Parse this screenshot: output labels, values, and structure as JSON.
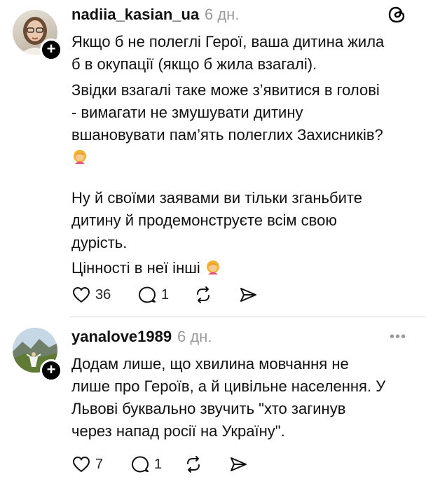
{
  "post1": {
    "username": "nadiia_kasian_ua",
    "time": "6 дн.",
    "lines_a": [
      "Якщо б не полеглі Герої, ваша дитина жила",
      "б в окупації (якщо б жила взагалі).",
      "Звідки взагалі таке може з’явитися в голові",
      "- вимагати не змушувати дитину",
      "вшановувати пам’ять полеглих Захисників?"
    ],
    "lines_b": [
      "Ну й своїми заявами ви тільки зганьбите",
      "дитину й продемонструєте всім свою",
      "дурість."
    ],
    "last_line": "Цінності в неї інші",
    "emoji_icon": "woman-facepalming-emoji",
    "likes": "36",
    "replies": "1"
  },
  "post2": {
    "username": "yanalove1989",
    "time": "6 дн.",
    "lines": [
      "Додам лише, що хвилина мовчання не",
      "лише про Героїв, а й цивільне населення. У",
      "Львові буквально звучить \"хто загинув",
      "через напад росії на Україну\"."
    ],
    "likes": "7",
    "replies": "1"
  },
  "icons": {
    "header": "threads-logo-icon",
    "more": "more-icon",
    "like": "heart-icon",
    "reply": "comment-icon",
    "repost": "repost-icon",
    "share": "share-icon"
  }
}
